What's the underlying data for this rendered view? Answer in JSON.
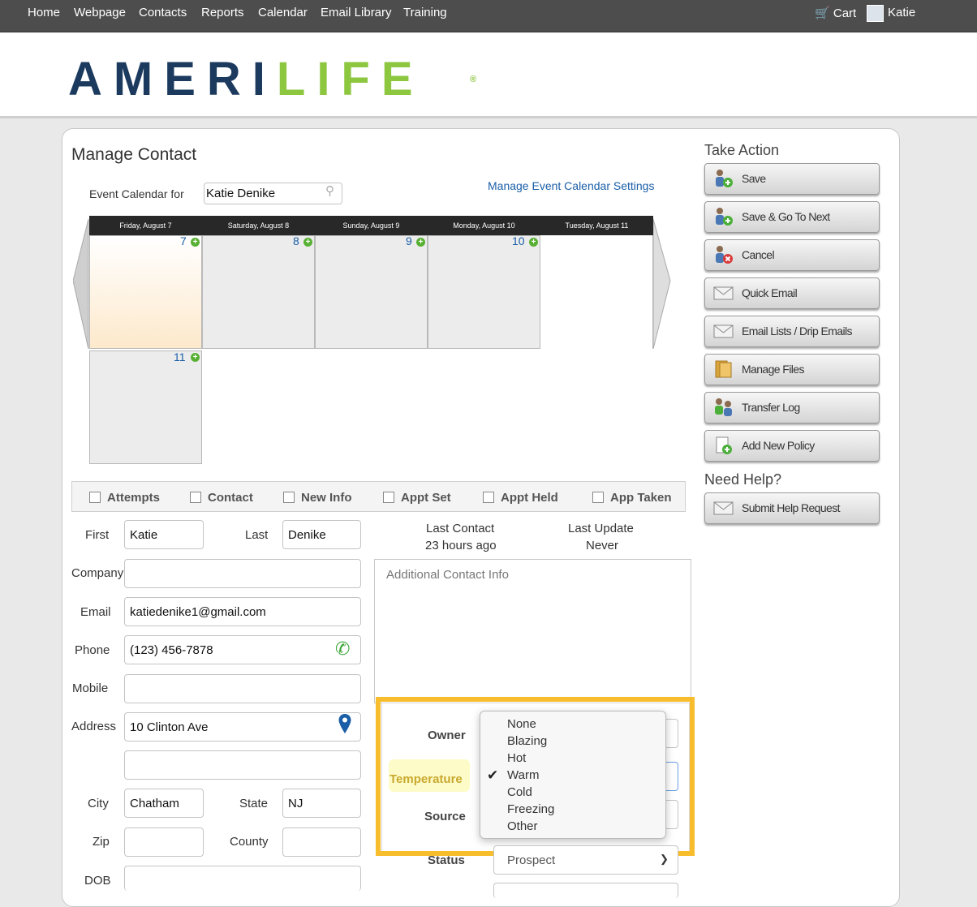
{
  "nav": {
    "items": [
      "Home",
      "Webpage",
      "Contacts",
      "Reports",
      "Calendar",
      "Email Library",
      "Training"
    ],
    "cart": "Cart",
    "user": "Katie"
  },
  "brand": {
    "ameri": "AMERI",
    "life": "LIFE",
    "reg": "®"
  },
  "page": {
    "title": "Manage Contact",
    "cal_for_label": "Event Calendar for",
    "cal_for_value": "Katie Denike",
    "cal_settings_link": "Manage Event Calendar Settings"
  },
  "calendar": {
    "days": [
      {
        "header": "Friday, August 7",
        "num": "7"
      },
      {
        "header": "Saturday, August 8",
        "num": "8"
      },
      {
        "header": "Sunday, August 9",
        "num": "9"
      },
      {
        "header": "Monday, August 10",
        "num": "10"
      },
      {
        "header": "Tuesday, August 11",
        "num": ""
      }
    ],
    "extra_num": "11"
  },
  "status_checks": [
    "Attempts",
    "Contact",
    "New Info",
    "Appt Set",
    "Appt Held",
    "App Taken"
  ],
  "form": {
    "first_label": "First",
    "first": "Katie",
    "last_label": "Last",
    "last": "Denike",
    "company_label": "Company",
    "company": "",
    "email_label": "Email",
    "email": "katiedenike1@gmail.com",
    "phone_label": "Phone",
    "phone": "(123) 456-7878",
    "mobile_label": "Mobile",
    "mobile": "",
    "address_label": "Address",
    "address": "10 Clinton Ave",
    "address2": "",
    "city_label": "City",
    "city": "Chatham",
    "state_label": "State",
    "state": "NJ",
    "zip_label": "Zip",
    "zip": "",
    "county_label": "County",
    "county": "",
    "dob_label": "DOB",
    "dob": ""
  },
  "info": {
    "last_contact_label": "Last Contact",
    "last_contact": "23 hours ago",
    "last_update_label": "Last Update",
    "last_update": "Never",
    "additional_placeholder": "Additional Contact Info"
  },
  "fields": {
    "owner_label": "Owner",
    "temperature_label": "Temperature",
    "source_label": "Source",
    "status_label": "Status",
    "status_value": "Prospect"
  },
  "temperature_dropdown": {
    "options": [
      "None",
      "Blazing",
      "Hot",
      "Warm",
      "Cold",
      "Freezing",
      "Other"
    ],
    "selected": "Warm"
  },
  "sidebar": {
    "take_action": "Take Action",
    "buttons": [
      "Save",
      "Save & Go To Next",
      "Cancel",
      "Quick Email",
      "Email Lists / Drip Emails",
      "Manage Files",
      "Transfer Log",
      "Add New Policy"
    ],
    "need_help": "Need Help?",
    "help_button": "Submit Help Request"
  }
}
